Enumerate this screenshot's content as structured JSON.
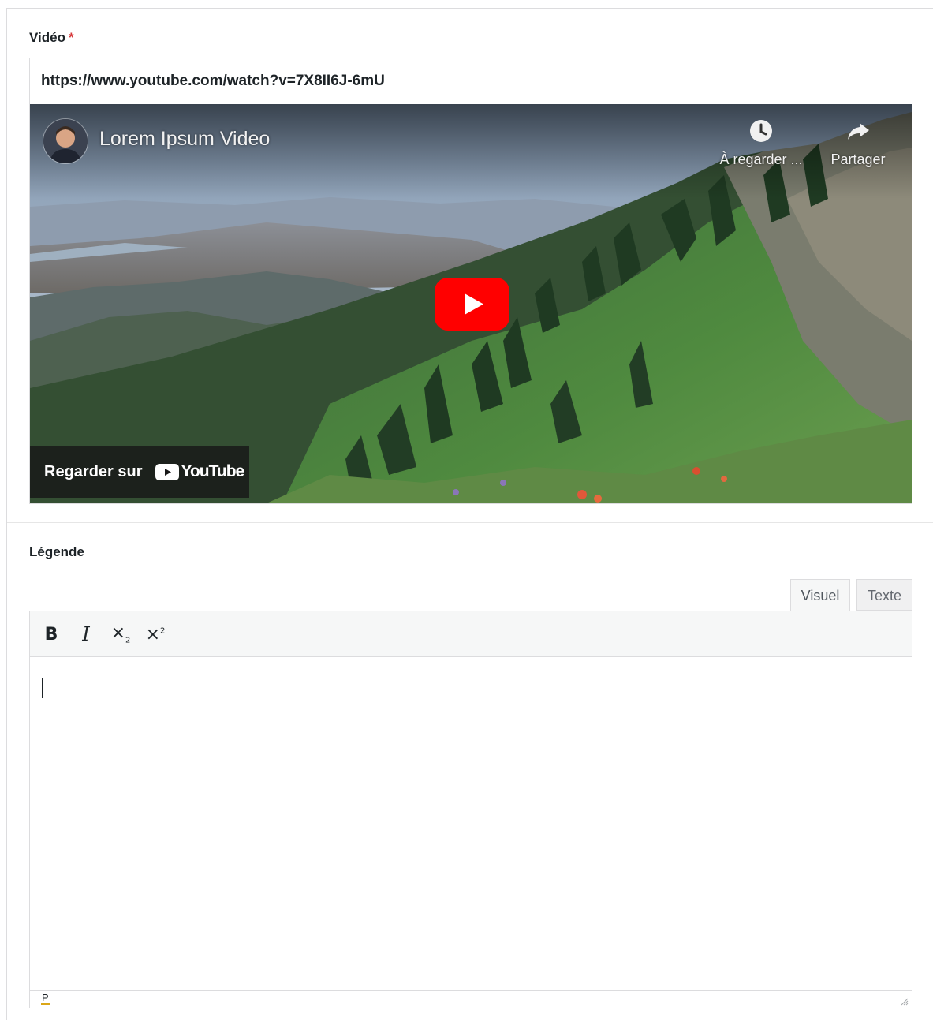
{
  "video_field": {
    "label": "Vidéo",
    "required_mark": "*",
    "url_value": "https://www.youtube.com/watch?v=7X8II6J-6mU",
    "player": {
      "title": "Lorem Ipsum Video",
      "watch_later_label": "À regarder ...",
      "share_label": "Partager",
      "watch_on_label": "Regarder sur",
      "youtube_wordmark": "YouTube",
      "play_icon": "play-button-icon",
      "accent_color": "#ff0000"
    }
  },
  "caption_field": {
    "label": "Légende",
    "tabs": {
      "visual": "Visuel",
      "text": "Texte",
      "active": "Visuel"
    },
    "toolbar": {
      "bold": "B",
      "italic": "I",
      "subscript_icon": "subscript-icon",
      "superscript_icon": "superscript-icon"
    },
    "content": "",
    "path_label": "P"
  }
}
